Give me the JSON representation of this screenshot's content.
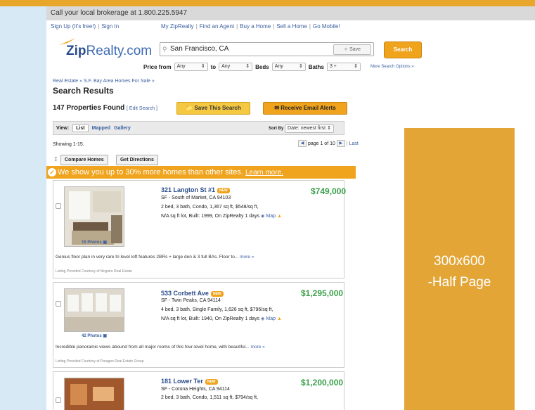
{
  "header": {
    "phone_text": "Call your local brokerage at 1.800.225.5947",
    "left_links": [
      "Sign Up (It's free!)",
      "Sign In"
    ],
    "right_links": [
      "My ZipRealty",
      "Find an Agent",
      "Buy a Home",
      "Sell a Home",
      "Go Mobile!"
    ]
  },
  "logo": {
    "bold": "Zip",
    "light": "Realty.com"
  },
  "search": {
    "value": "San Francisco, CA",
    "save_label": "Save",
    "button_label": "Search"
  },
  "filters": {
    "price_from_label": "Price from",
    "price_from": "Any",
    "to_label": "to",
    "price_to": "Any",
    "beds_label": "Beds",
    "beds": "Any",
    "baths_label": "Baths",
    "baths": "3 +",
    "more_options": "More Search Options »"
  },
  "breadcrumb": "Real Estate  »  S.F. Bay Area Homes For Sale  »",
  "results": {
    "title": "Search Results",
    "count": "147 Properties Found",
    "edit_search": "[ Edit Search ]",
    "save_search": "Save This Search",
    "email_alerts": "Receive Email Alerts"
  },
  "viewbar": {
    "view_label": "View:",
    "list": "List",
    "mapped": "Mapped",
    "gallery": "Gallery",
    "sort_label": "Sort By",
    "sort_value": "Date: newest first"
  },
  "pagination": {
    "showing": "Showing 1-15.",
    "page_text": "page 1 of 10",
    "last": "Last"
  },
  "tools": {
    "compare": "Compare Homes",
    "directions": "Get Directions"
  },
  "banner": {
    "text": "We show you up to 30% more homes than other sites.",
    "learn_more": "Learn more."
  },
  "listings": [
    {
      "address": "321 Langton St #1",
      "badge": "NEW",
      "price": "$749,000",
      "neighborhood": "SF - South of Market, CA 94103",
      "line1": "2 bed, 3 bath, Condo, 1,367 sq ft, $548/sq ft,",
      "line2": "N/A sq ft lot, Built: 1999, On ZipRealty 1 days",
      "map": "Map",
      "photos": "15 Photos",
      "description": "Genius floor plan in very rare tri level loft features 2BRs + large den & 3 full BAs. Floor to...",
      "more": "more »",
      "courtesy": "Listing Provided Courtesy of Mcguire Real Estate"
    },
    {
      "address": "533 Corbett Ave",
      "badge": "NEW",
      "price": "$1,295,000",
      "neighborhood": "SF - Twin Peaks, CA 94114",
      "line1": "4 bed, 3 bath, Single Family, 1,626 sq ft, $796/sq ft,",
      "line2": "N/A sq ft lot, Built: 1940, On ZipRealty 1 days",
      "map": "Map",
      "photos": "42 Photos",
      "description": "Incredible panoramic views abound from all major rooms of this four-level home, with beautiful...",
      "more": "more »",
      "courtesy": "Listing Provided Courtesy of Paragon Real Estate Group"
    },
    {
      "address": "181 Lower Ter",
      "badge": "NEW",
      "price": "$1,200,000",
      "neighborhood": "SF - Corona Heights, CA 94114",
      "line1": "2 bed, 3 bath, Condo, 1,511 sq ft, $794/sq ft,"
    }
  ],
  "ad": {
    "line1": "300x600",
    "line2": "-Half Page",
    "color": "#e3a536"
  }
}
